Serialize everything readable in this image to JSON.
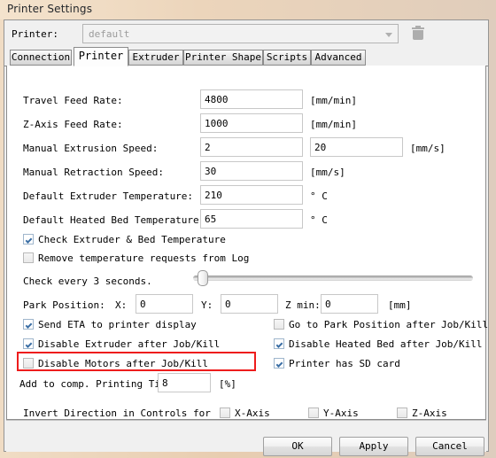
{
  "window": {
    "title": "Printer Settings"
  },
  "printer_row": {
    "label": "Printer:",
    "selected": "default",
    "delete_icon": "trash-icon",
    "dropdown_icon": "chevron-down-icon"
  },
  "tabs": [
    {
      "label": "Connection",
      "active": false
    },
    {
      "label": "Printer",
      "active": true
    },
    {
      "label": "Extruder",
      "active": false
    },
    {
      "label": "Printer Shape",
      "active": false
    },
    {
      "label": "Scripts",
      "active": false
    },
    {
      "label": "Advanced",
      "active": false
    }
  ],
  "fields": [
    {
      "label": "Travel Feed Rate:",
      "value": "4800",
      "unit": "[mm/min]"
    },
    {
      "label": "Z-Axis Feed Rate:",
      "value": "1000",
      "unit": "[mm/min]"
    },
    {
      "label": "Manual Extrusion Speed:",
      "value": "2",
      "value2": "20",
      "unit": "[mm/s]"
    },
    {
      "label": "Manual Retraction Speed:",
      "value": "30",
      "unit": "[mm/s]"
    },
    {
      "label": "Default Extruder Temperature:",
      "value": "210",
      "unit": "° C"
    },
    {
      "label": "Default Heated Bed Temperature:",
      "value": "65",
      "unit": "° C"
    }
  ],
  "temp_checks": [
    {
      "label": "Check Extruder & Bed Temperature",
      "checked": true
    },
    {
      "label": "Remove temperature requests from Log",
      "checked": false
    }
  ],
  "check_interval": {
    "label": "Check every 3 seconds.",
    "slider_position_percent": 2
  },
  "park_position": {
    "label": "Park Position:",
    "x_label": "X:",
    "x_value": "0",
    "y_label": "Y:",
    "y_value": "0",
    "z_label": "Z min:",
    "z_value": "0",
    "unit": "[mm]"
  },
  "job_options_left": [
    {
      "label": "Send ETA to printer display",
      "checked": true
    },
    {
      "label": "Disable Extruder after Job/Kill",
      "checked": true
    },
    {
      "label": "Disable Motors after Job/Kill",
      "checked": false,
      "highlighted": true
    }
  ],
  "job_options_right": [
    {
      "label": "Go to Park Position after Job/Kill",
      "checked": false
    },
    {
      "label": "Disable Heated Bed after Job/Kill",
      "checked": true
    },
    {
      "label": "Printer has SD card",
      "checked": true
    }
  ],
  "printing_time": {
    "label": "Add to comp. Printing Time",
    "value": "8",
    "unit": "[%]"
  },
  "invert_direction": {
    "label": "Invert Direction in Controls for",
    "axes": [
      {
        "label": "X-Axis",
        "checked": false
      },
      {
        "label": "Y-Axis",
        "checked": false
      },
      {
        "label": "Z-Axis",
        "checked": false
      }
    ]
  },
  "buttons": [
    {
      "label": "OK"
    },
    {
      "label": "Apply"
    },
    {
      "label": "Cancel"
    }
  ],
  "colors": {
    "titlebar_start": "#f4e3cd",
    "titlebar_end": "#e0cdbb",
    "highlight_red": "#ee1c1c",
    "check_blue": "#3a6ea5",
    "panel_bg": "#ffffff",
    "dialog_bg": "#f0f0f0"
  }
}
